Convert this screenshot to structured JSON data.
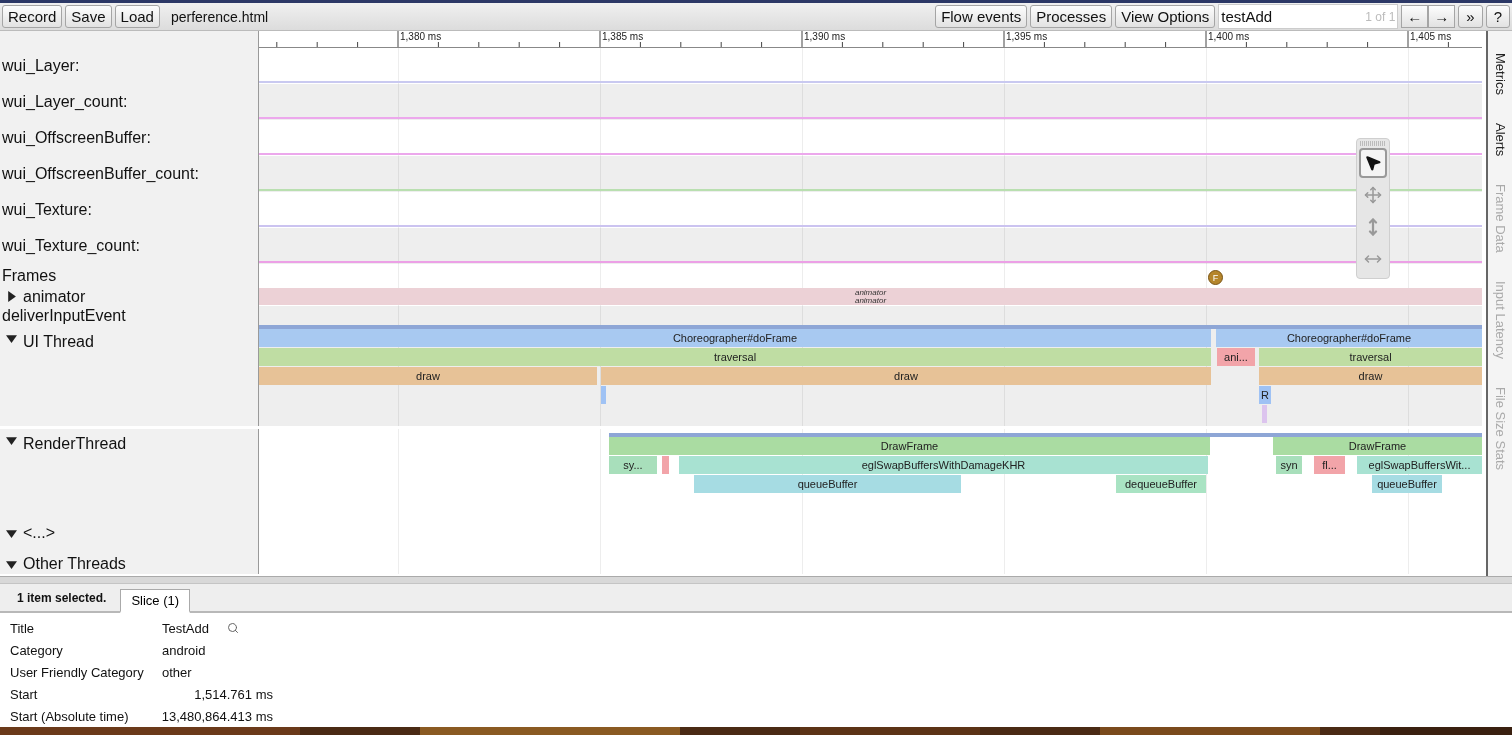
{
  "toolbar": {
    "buttons": [
      "Record",
      "Save",
      "Load"
    ],
    "filename": "perference.html",
    "right_buttons": [
      "Flow events",
      "Processes",
      "View Options"
    ],
    "search": {
      "value": "testAdd"
    },
    "match_count": "1 of 1",
    "nav_buttons": [
      "←",
      "→"
    ],
    "extra_buttons": [
      "»",
      "?"
    ]
  },
  "ruler": {
    "ticks": [
      "1,380 ms",
      "1,385 ms",
      "1,390 ms",
      "1,395 ms",
      "1,400 ms",
      "1,405 ms"
    ]
  },
  "tracks": [
    {
      "kind": "counter",
      "label": "wui_Layer:",
      "color": "#c9c9f0"
    },
    {
      "kind": "counter",
      "label": "wui_Layer_count:",
      "color": "#eca8ec"
    },
    {
      "kind": "counter",
      "label": "wui_OffscreenBuffer:",
      "color": "#eca8ec"
    },
    {
      "kind": "counter",
      "label": "wui_OffscreenBuffer_count:",
      "color": "#b9dfb0"
    },
    {
      "kind": "counter",
      "label": "wui_Texture:",
      "color": "#cbc3f0"
    },
    {
      "kind": "counter",
      "label": "wui_Texture_count:",
      "color": "#eca0e6"
    },
    {
      "kind": "frames",
      "label": "Frames",
      "markers": [
        {
          "text": "F"
        }
      ]
    },
    {
      "kind": "collapsed",
      "label": "animator",
      "expanded": false,
      "bar_texts": [
        "animator",
        "animator"
      ]
    },
    {
      "kind": "empty",
      "label": "deliverInputEvent"
    },
    {
      "kind": "ui_thread",
      "label": "UI Thread",
      "expanded": true,
      "slices": [
        {
          "label": "Choreographer#doFrame",
          "color": "#a8c9f1"
        },
        {
          "label": "Choreographer#doFrame",
          "color": "#a8c9f1"
        },
        {
          "label": "traversal",
          "color": "#bfdda3"
        },
        {
          "label": "ani...",
          "color": "#f2a4a9"
        },
        {
          "label": "traversal",
          "color": "#bfdda3"
        },
        {
          "label": "draw",
          "color": "#e7c297"
        },
        {
          "label": "draw",
          "color": "#e7c297"
        },
        {
          "label": "draw",
          "color": "#e7c297"
        },
        {
          "color": "#9fc2f4"
        },
        {
          "label": "R",
          "color": "#9fc2f4"
        },
        {
          "color": "#dcc4ee"
        }
      ]
    },
    {
      "kind": "render_thread",
      "label": "RenderThread",
      "expanded": true,
      "slices": [
        {
          "label": "DrawFrame",
          "color": "#aadca2"
        },
        {
          "label": "DrawFrame",
          "color": "#aadca2"
        },
        {
          "label": "sy...",
          "color": "#a8dfbb"
        },
        {
          "color": "#f2a4a9"
        },
        {
          "label": "eglSwapBuffersWithDamageKHR",
          "color": "#a8e2d2"
        },
        {
          "label": "syn",
          "color": "#a8dfbb"
        },
        {
          "label": "fl...",
          "color": "#f2a4a9"
        },
        {
          "label": "eglSwapBuffersWit...",
          "color": "#a8e2d2"
        },
        {
          "label": "queueBuffer",
          "color": "#a6dce3"
        },
        {
          "label": "dequeueBuffer",
          "color": "#a9e3c3"
        },
        {
          "label": "queueBuffer",
          "color": "#a6dce3"
        }
      ]
    },
    {
      "kind": "empty",
      "label": "<...>",
      "expanded": true
    },
    {
      "kind": "empty",
      "label": "Other Threads",
      "expanded": true
    }
  ],
  "nav_tools": [
    {
      "kind": "select",
      "selected": true
    },
    {
      "kind": "pan",
      "selected": false
    },
    {
      "kind": "zoom",
      "selected": false
    },
    {
      "kind": "timing",
      "selected": false
    }
  ],
  "side_tabs": [
    {
      "label": "Metrics",
      "disabled": false
    },
    {
      "label": "Alerts",
      "disabled": false
    },
    {
      "label": "Frame Data",
      "disabled": true
    },
    {
      "label": "Input Latency",
      "disabled": true
    },
    {
      "label": "File Size Stats",
      "disabled": true
    }
  ],
  "selection": {
    "summary": "1 item selected.",
    "tabs": [
      {
        "label": "Slice (1)",
        "selected": true
      }
    ],
    "rows": [
      {
        "kind": "title",
        "label": "Title",
        "value": "TestAdd"
      },
      {
        "kind": "text",
        "label": "Category",
        "value": "android"
      },
      {
        "kind": "text",
        "label": "User Friendly Category",
        "value": "other"
      },
      {
        "kind": "time",
        "label": "Start",
        "value": "1,514.761 ms"
      },
      {
        "kind": "time",
        "label": "Start (Absolute time)",
        "value": "13,480,864.413 ms"
      }
    ]
  }
}
